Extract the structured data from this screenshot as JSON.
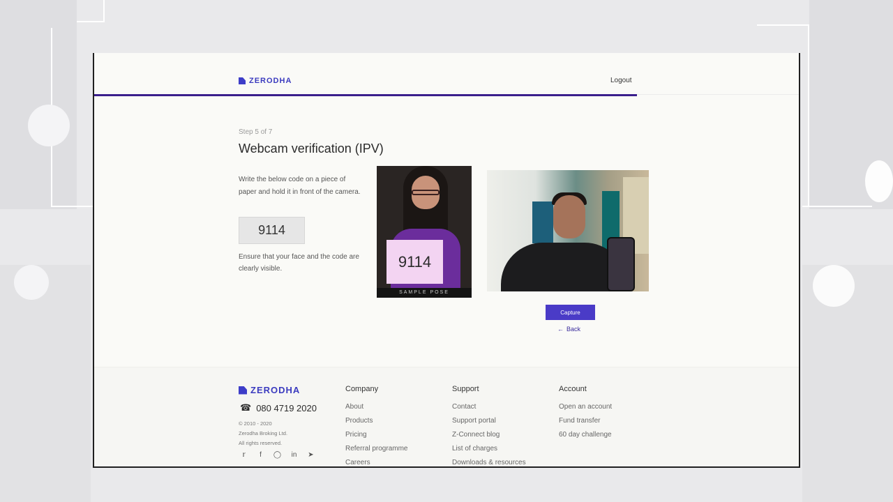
{
  "header": {
    "brand": "ZERODHA",
    "logout_label": "Logout",
    "progress_fraction": 0.77
  },
  "main": {
    "step_label": "Step 5 of 7",
    "title": "Webcam verification (IPV)",
    "instruction": "Write the below code on a piece of paper and hold it in front of the camera.",
    "code": "9114",
    "ensure_text": "Ensure that your face and the code are clearly visible.",
    "sample_card_code": "9114",
    "sample_caption": "SAMPLE POSE",
    "capture_label": "Capture",
    "back_label": "Back"
  },
  "footer": {
    "brand": "ZERODHA",
    "phone": "080 4719 2020",
    "copyright": "© 2010 - 2020",
    "company_name": "Zerodha Broking Ltd.",
    "rights": "All rights reserved.",
    "columns": [
      {
        "heading": "Company",
        "links": [
          "About",
          "Products",
          "Pricing",
          "Referral programme",
          "Careers"
        ]
      },
      {
        "heading": "Support",
        "links": [
          "Contact",
          "Support portal",
          "Z-Connect blog",
          "List of charges",
          "Downloads & resources"
        ]
      },
      {
        "heading": "Account",
        "links": [
          "Open an account",
          "Fund transfer",
          "60 day challenge"
        ]
      }
    ],
    "social_icons": [
      "twitter-icon",
      "facebook-icon",
      "instagram-icon",
      "linkedin-icon",
      "telegram-icon"
    ]
  },
  "colors": {
    "brand": "#3d3dc8",
    "progress": "#3a1e8c",
    "capture_button": "#4a3bc7"
  }
}
